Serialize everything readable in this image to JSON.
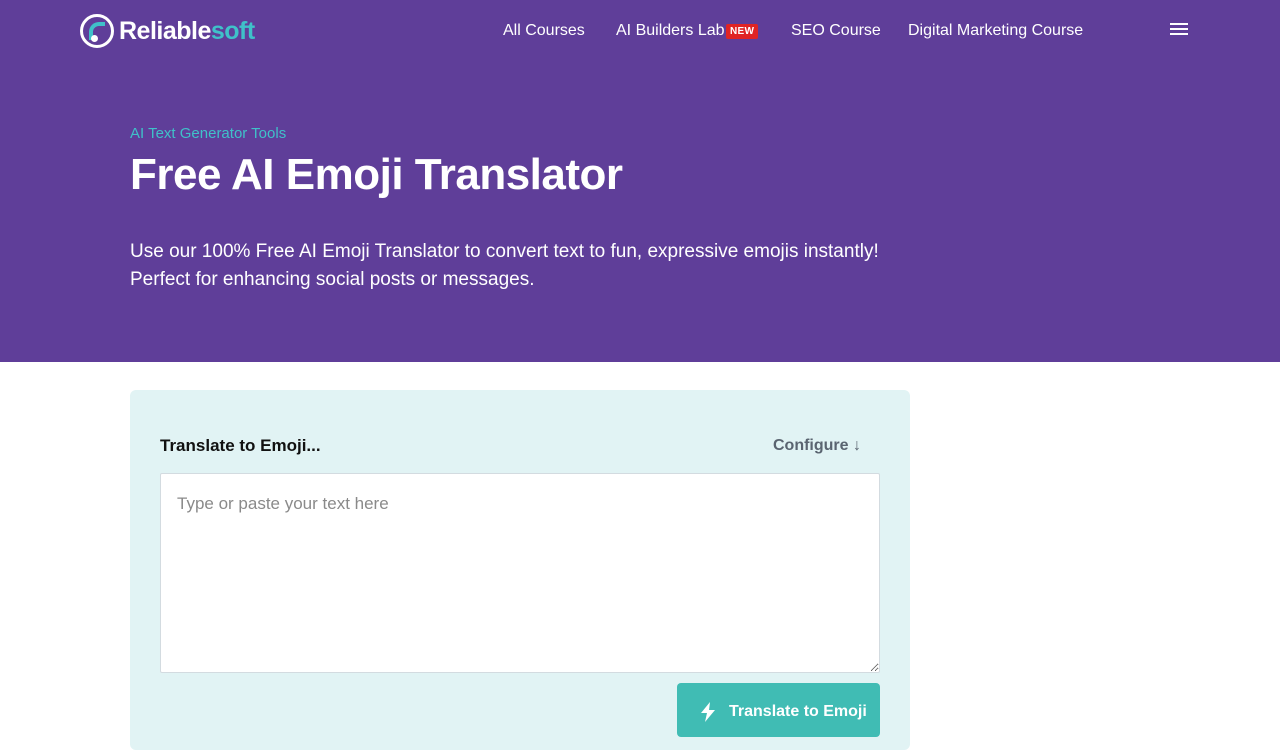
{
  "brand": {
    "name_part1": "Reliable",
    "name_part2": "soft",
    "primary_color": "#5f3e99",
    "accent_color": "#3fc1c9"
  },
  "nav": {
    "items": [
      {
        "label": "All Courses"
      },
      {
        "label": "AI Builders Lab",
        "badge": "NEW"
      },
      {
        "label": "SEO Course"
      },
      {
        "label": "Digital Marketing Course"
      }
    ],
    "menu_icon": "hamburger-menu-icon"
  },
  "hero": {
    "breadcrumb": "AI Text Generator Tools",
    "title": "Free AI Emoji Translator",
    "description": "Use our 100% Free AI Emoji Translator to convert text to fun, expressive emojis instantly! Perfect for enhancing social posts or messages."
  },
  "tool": {
    "title": "Translate to Emoji...",
    "configure_label": "Configure ↓",
    "input_placeholder": "Type or paste your text here",
    "input_value": "",
    "submit_label": "Translate to Emoji",
    "submit_icon": "lightning-bolt-icon",
    "button_color": "#40bcb4"
  }
}
